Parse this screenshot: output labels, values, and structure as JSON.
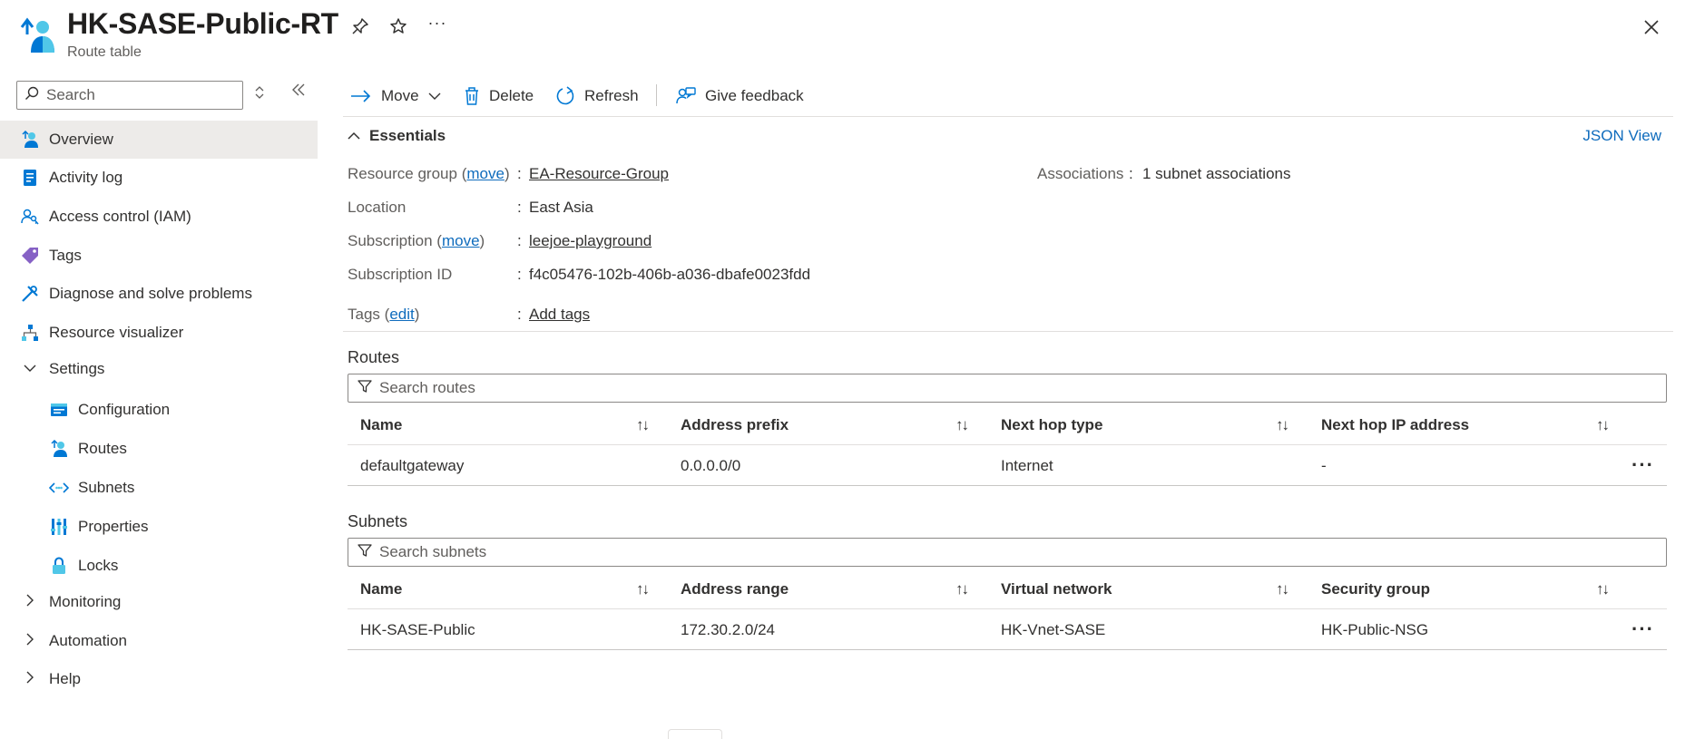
{
  "header": {
    "title": "HK-SASE-Public-RT",
    "subtitle": "Route table",
    "icons": [
      "route-table-icon",
      "pin-icon",
      "star-icon",
      "more-icon",
      "close-icon"
    ]
  },
  "sidebar": {
    "search_placeholder": "Search",
    "items": [
      {
        "label": "Overview",
        "icon": "overview-icon"
      },
      {
        "label": "Activity log",
        "icon": "activity-log-icon"
      },
      {
        "label": "Access control (IAM)",
        "icon": "iam-icon"
      },
      {
        "label": "Tags",
        "icon": "tag-icon"
      },
      {
        "label": "Diagnose and solve problems",
        "icon": "wrench-icon"
      },
      {
        "label": "Resource visualizer",
        "icon": "visualizer-icon"
      },
      {
        "label": "Settings",
        "icon": "chevron-down-icon"
      },
      {
        "label": "Configuration",
        "icon": "configuration-icon"
      },
      {
        "label": "Routes",
        "icon": "routes-icon"
      },
      {
        "label": "Subnets",
        "icon": "subnets-icon"
      },
      {
        "label": "Properties",
        "icon": "properties-icon"
      },
      {
        "label": "Locks",
        "icon": "lock-icon"
      },
      {
        "label": "Monitoring",
        "icon": "chevron-right-icon"
      },
      {
        "label": "Automation",
        "icon": "chevron-right-icon"
      },
      {
        "label": "Help",
        "icon": "chevron-right-icon"
      }
    ]
  },
  "toolbar": {
    "move": "Move",
    "delete": "Delete",
    "refresh": "Refresh",
    "feedback": "Give feedback"
  },
  "essentials": {
    "title": "Essentials",
    "json_view": "JSON View",
    "resource_group_label": "Resource group",
    "move_link": "move",
    "resource_group_value": "EA-Resource-Group",
    "location_label": "Location",
    "location_value": "East Asia",
    "subscription_label": "Subscription",
    "subscription_value": "leejoe-playground",
    "subscription_id_label": "Subscription ID",
    "subscription_id_value": "f4c05476-102b-406b-a036-dbafe0023fdd",
    "tags_label": "Tags",
    "edit_link": "edit",
    "tags_value": "Add tags",
    "associations_label": "Associations",
    "associations_value": "1 subnet associations",
    "colon": ":"
  },
  "routes": {
    "title": "Routes",
    "search_placeholder": "Search routes",
    "columns": [
      "Name",
      "Address prefix",
      "Next hop type",
      "Next hop IP address"
    ],
    "rows": [
      [
        "defaultgateway",
        "0.0.0.0/0",
        "Internet",
        "-"
      ]
    ]
  },
  "subnets": {
    "title": "Subnets",
    "search_placeholder": "Search subnets",
    "columns": [
      "Name",
      "Address range",
      "Virtual network",
      "Security group"
    ],
    "rows": [
      [
        "HK-SASE-Public",
        "172.30.2.0/24",
        "HK-Vnet-SASE",
        "HK-Public-NSG"
      ]
    ]
  },
  "glyphs": {
    "sort": "↑↓",
    "more": "···",
    "paren_open": "(",
    "paren_close": ")"
  }
}
